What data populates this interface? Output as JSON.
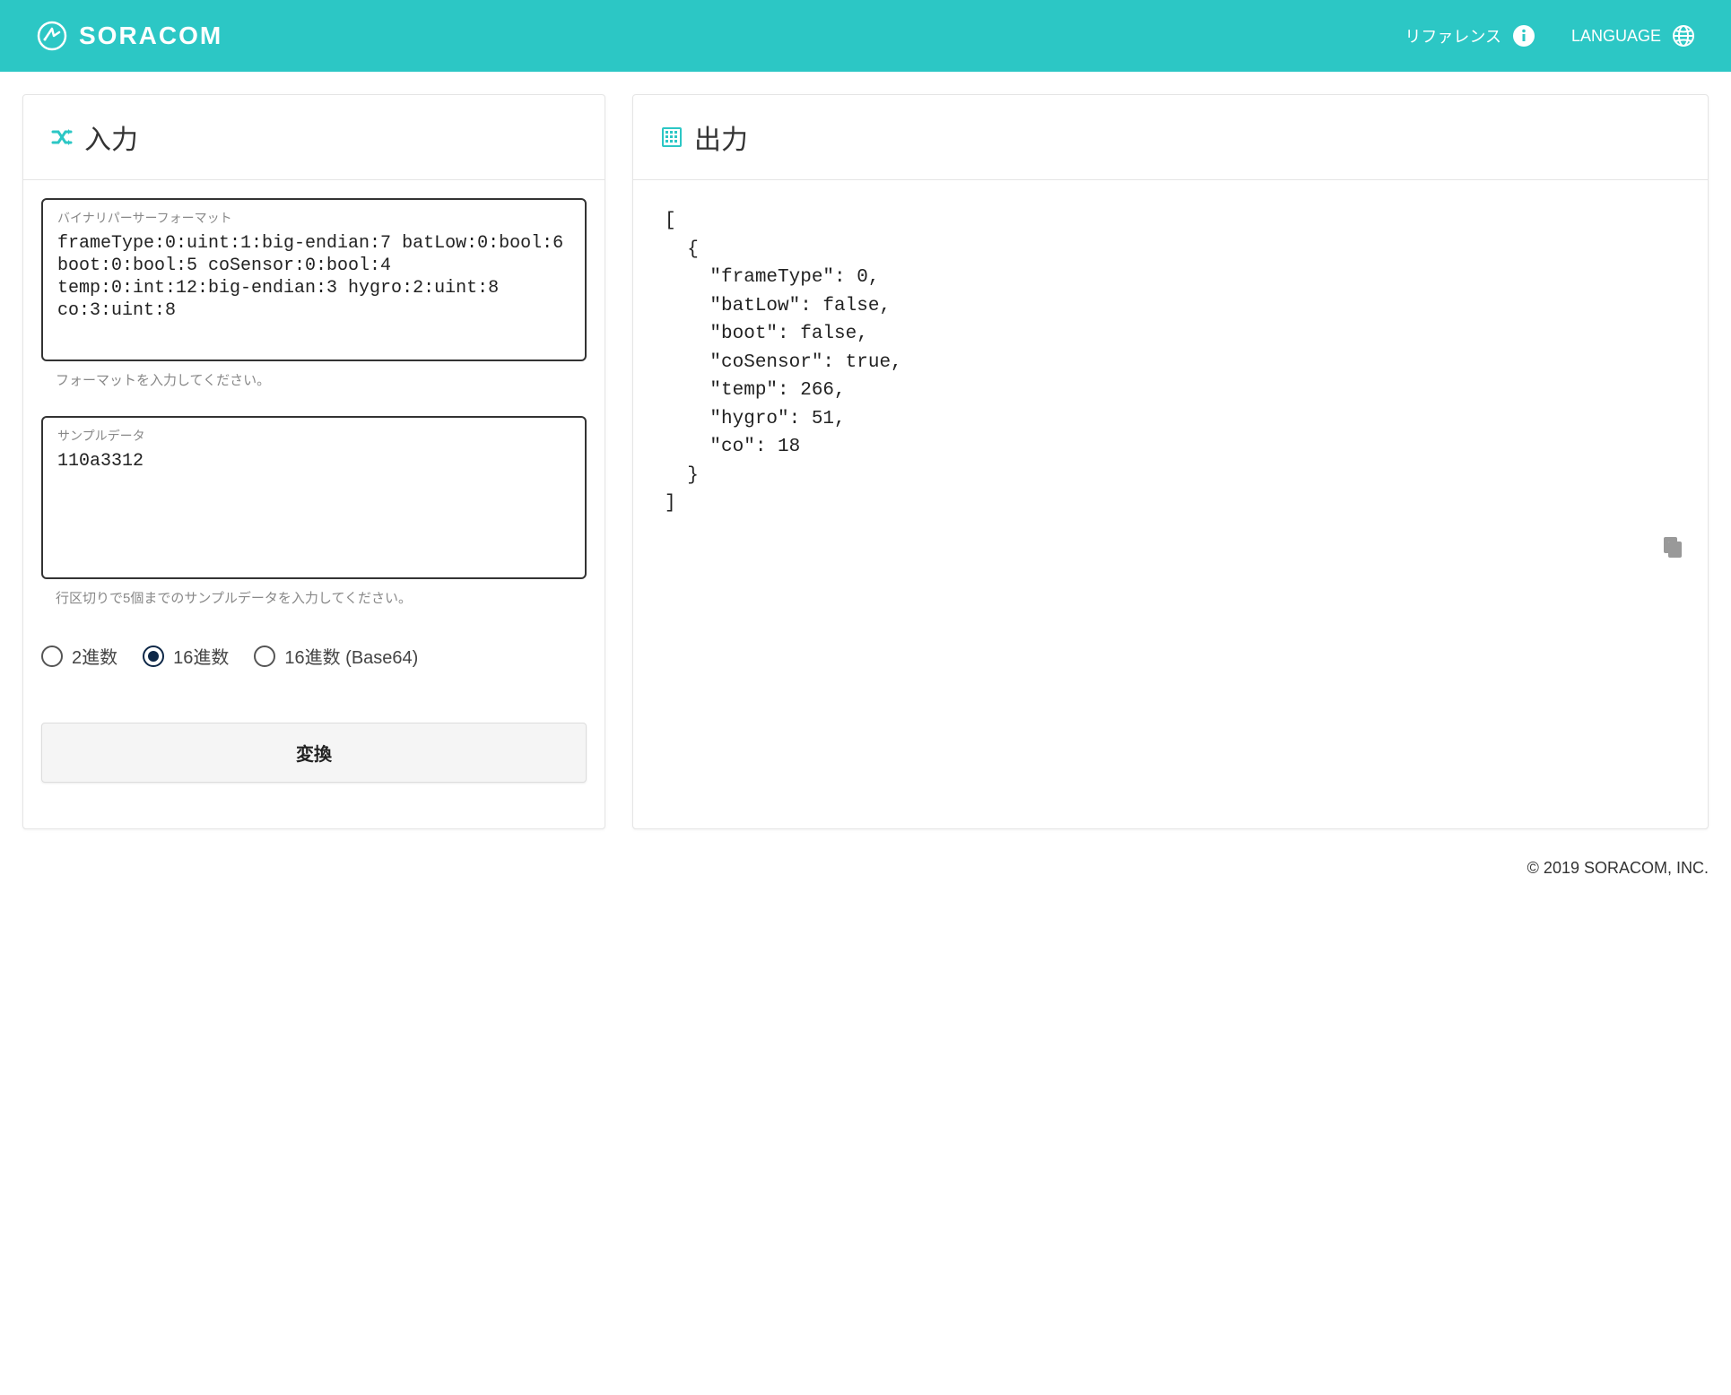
{
  "header": {
    "brand": "SORACOM",
    "reference_label": "リファレンス",
    "language_label": "LANGUAGE"
  },
  "input_panel": {
    "title": "入力",
    "format_label": "バイナリパーサーフォーマット",
    "format_value": "frameType:0:uint:1:big-endian:7 batLow:0:bool:6 boot:0:bool:5 coSensor:0:bool:4 temp:0:int:12:big-endian:3 hygro:2:uint:8 co:3:uint:8",
    "format_helper": "フォーマットを入力してください。",
    "sample_label": "サンプルデータ",
    "sample_value": "110a3312",
    "sample_helper": "行区切りで5個までのサンプルデータを入力してください。",
    "radio_options": [
      {
        "label": "2進数",
        "selected": false
      },
      {
        "label": "16進数",
        "selected": true
      },
      {
        "label": "16進数 (Base64)",
        "selected": false
      }
    ],
    "convert_label": "変換"
  },
  "output_panel": {
    "title": "出力",
    "result": "[\n  {\n    \"frameType\": 0,\n    \"batLow\": false,\n    \"boot\": false,\n    \"coSensor\": true,\n    \"temp\": 266,\n    \"hygro\": 51,\n    \"co\": 18\n  }\n]"
  },
  "footer": {
    "copyright": "© 2019 SORACOM, INC."
  }
}
